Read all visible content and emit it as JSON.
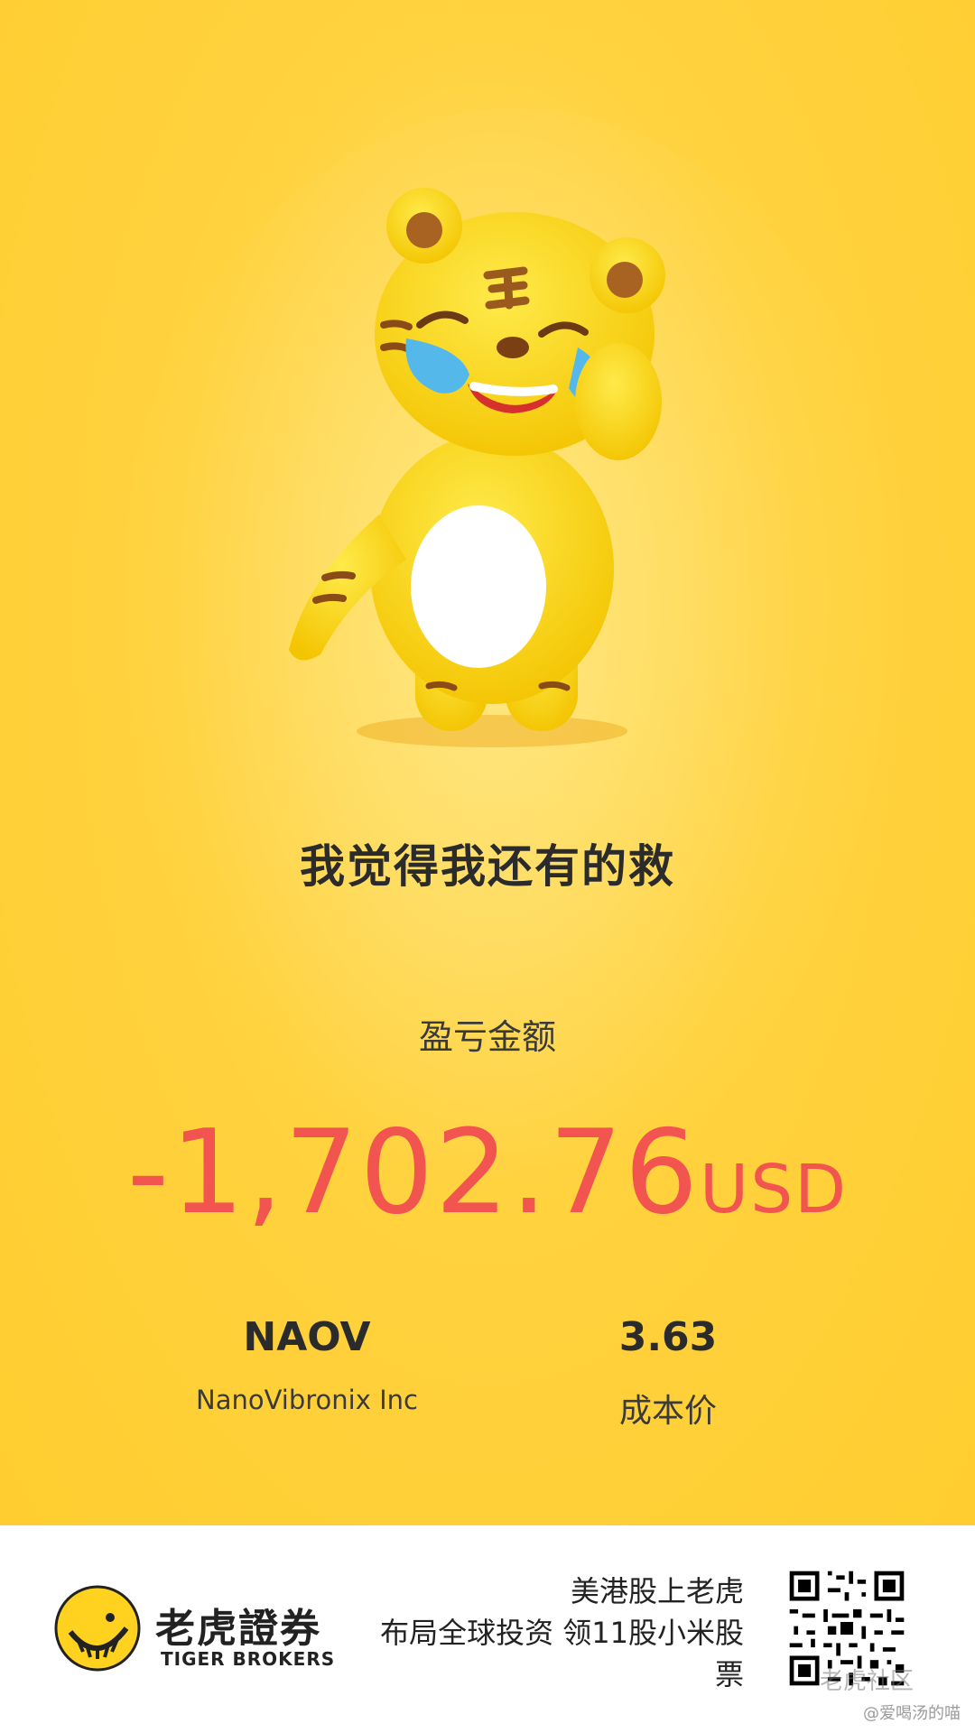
{
  "headline": "我觉得我还有的救",
  "pnl": {
    "label": "盈亏金额",
    "amount": "-1,702.76",
    "currency": "USD"
  },
  "stock": {
    "ticker": "NAOV",
    "company": "NanoVibronix Inc",
    "cost_price": "3.63",
    "cost_label": "成本价"
  },
  "footer": {
    "brand_cn": "老虎證券",
    "brand_en": "TIGER BROKERS",
    "promo_lines": [
      "美港股上老虎",
      "布局全球投资 领11股小米股",
      "票"
    ],
    "watermark_community": "老虎社区",
    "watermark_user": "@爱喝汤的喵"
  },
  "colors": {
    "background": "#ffd23f",
    "loss_red": "#f2544f",
    "text_dark": "#2b2b2b"
  },
  "icons": {
    "mascot": "crying-tiger-mascot",
    "logo": "tiger-brokers-logo",
    "qr": "qr-code"
  }
}
